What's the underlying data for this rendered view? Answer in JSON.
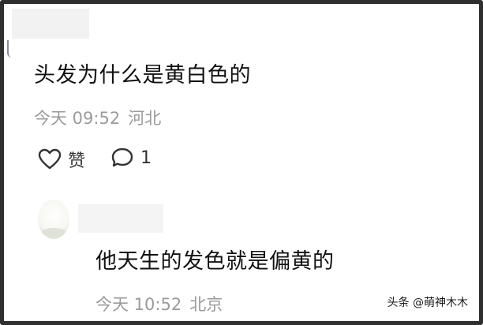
{
  "comment1": {
    "text": "头发为什么是黄白色的",
    "time": "今天 09:52",
    "location": "河北",
    "like_label": "赞",
    "reply_count": "1"
  },
  "comment2": {
    "text": "他天生的发色就是偏黄的",
    "time": "今天 10:52",
    "location": "北京"
  },
  "watermark": "头条 @萌神木木",
  "icons": {
    "like": "heart-outline-icon",
    "reply": "speech-bubble-icon"
  },
  "colors": {
    "text": "#111111",
    "meta": "#9b9b9b",
    "border": "#2f2f2f"
  }
}
